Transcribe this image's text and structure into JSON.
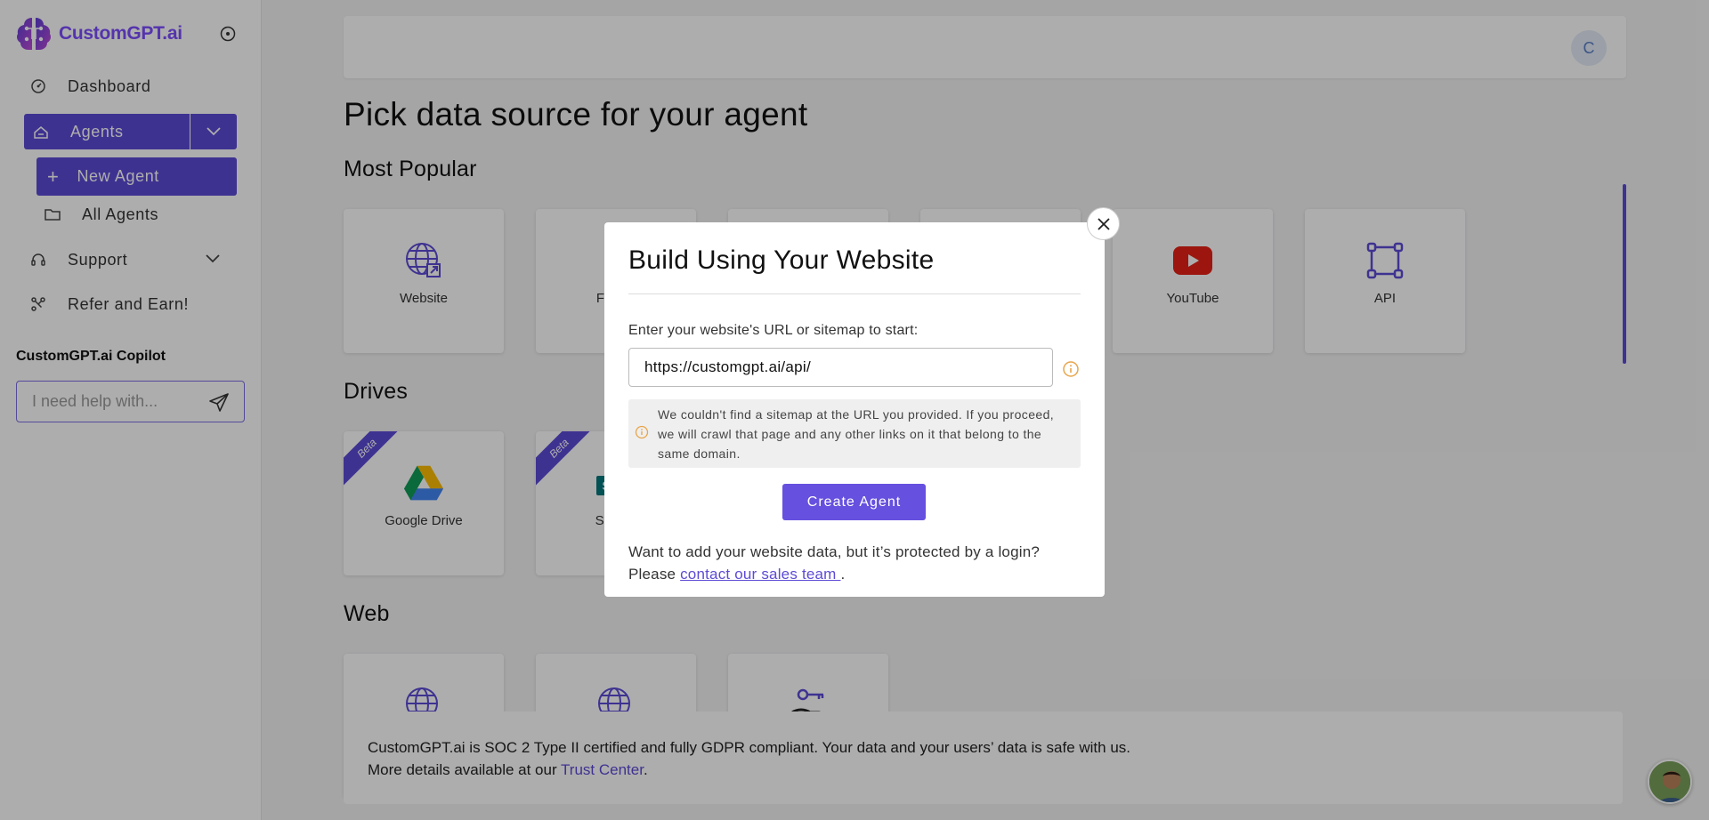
{
  "app": {
    "brand": "CustomGPT.ai",
    "brand_color": "#7c4dff",
    "accent": "#5c4bd6"
  },
  "sidebar": {
    "items": [
      {
        "label": "Dashboard",
        "icon": "dashboard-icon"
      },
      {
        "label": "Agents",
        "icon": "home-icon"
      },
      {
        "label": "New Agent",
        "icon": "plus-icon"
      },
      {
        "label": "All Agents",
        "icon": "folder-icon"
      },
      {
        "label": "Support",
        "icon": "headset-icon"
      },
      {
        "label": "Refer and Earn!",
        "icon": "share-icon"
      }
    ],
    "copilot": {
      "title": "CustomGPT.ai Copilot",
      "placeholder": "I need help with..."
    }
  },
  "header": {
    "avatar_initial": "C"
  },
  "main": {
    "title": "Pick data source for your agent",
    "sections": {
      "popular": {
        "title": "Most Popular",
        "cards": [
          "Website",
          "File",
          "YouTube",
          "API"
        ]
      },
      "drives": {
        "title": "Drives",
        "badge": "Beta",
        "cards": [
          "Google Drive",
          "Sha"
        ]
      },
      "web": {
        "title": "Web"
      }
    },
    "footer": {
      "line1": "CustomGPT.ai is SOC 2 Type II certified and fully GDPR compliant. Your data and your users’ data is safe with us.",
      "line2_prefix": "More details available at our ",
      "line2_link": "Trust Center",
      "line2_suffix": "."
    }
  },
  "modal": {
    "title": "Build Using Your Website",
    "label": "Enter your website's URL or sitemap to start:",
    "url_value": "https://customgpt.ai/api/",
    "warning": "We couldn't find a sitemap at the URL you provided. If you proceed, we will crawl that page and any other links on it that belong to the same domain.",
    "create_label": "Create Agent",
    "note_prefix": "Want to add your website data, but it’s protected by a login? Please ",
    "note_link": "contact our sales team ",
    "note_suffix": "."
  }
}
